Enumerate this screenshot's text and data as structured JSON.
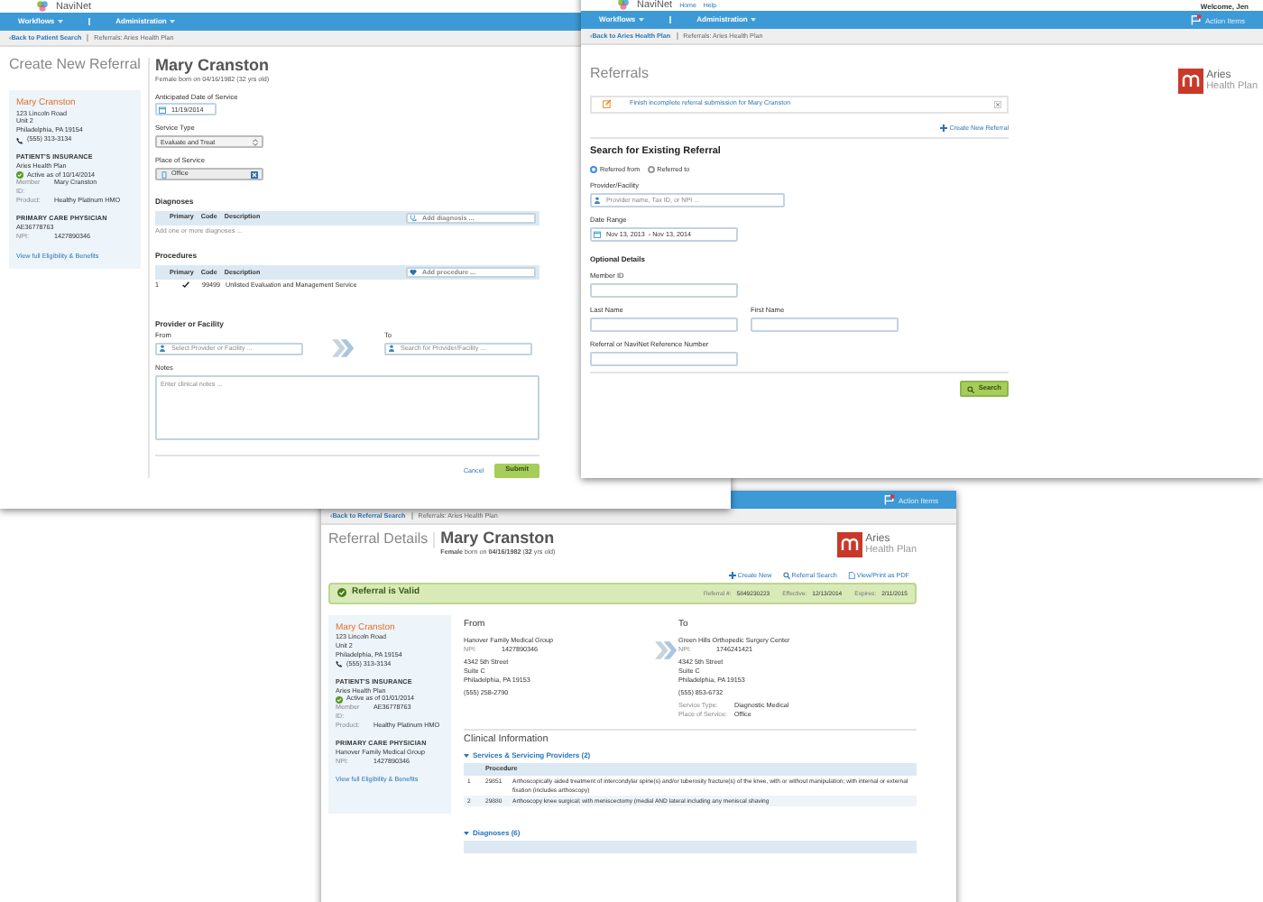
{
  "create_referral": {
    "logo": "NaviNet",
    "nav": [
      "Workflows",
      "Administration"
    ],
    "breadcrumb": {
      "back": "‹Back to Patient Search",
      "current": "Referrals: Aries Health Plan"
    },
    "title": "Create New Referral",
    "patient_card": {
      "name": "Mary Cranston",
      "address": [
        "123 Lincoln Road",
        "Unit 2",
        "Philadelphia, PA 19154"
      ],
      "phone": "(555) 313-3134",
      "insurance_heading": "PATIENT'S INSURANCE",
      "insurer": "Aries Health Plan",
      "status": "Active as of 10/14/2014",
      "fields": [
        {
          "label": "Member ID:",
          "value": "Mary Cranston"
        },
        {
          "label": "Product:",
          "value": "Healthy Platinum HMO"
        }
      ],
      "pcp_heading": "PRIMARY CARE PHYSICIAN",
      "pcp_name": "AE36778763",
      "pcp_npi": {
        "label": "NPI:",
        "value": "1427890346"
      },
      "link": "View full Eligibility & Benefits"
    },
    "patient_name": "Mary Cranston",
    "patient_info": "Female born on 04/16/1982 (32 yrs old)",
    "date_label": "Anticipated Date of Service",
    "date_value": "11/19/2014",
    "service_type_label": "Service Type",
    "service_type_value": "Evaluate and Treat",
    "place_label": "Place of Service",
    "place_value": "Office",
    "diagnoses": {
      "heading": "Diagnoses",
      "columns": [
        "Primary",
        "Code",
        "Description"
      ],
      "add_placeholder": "Add diagnosis ...",
      "empty_hint": "Add one or more diagnoses ..."
    },
    "procedures": {
      "heading": "Procedures",
      "columns": [
        "Primary",
        "Code",
        "Description"
      ],
      "add_placeholder": "Add procedure ...",
      "rows": [
        {
          "index": "1",
          "primary": true,
          "code": "99499",
          "description": "Unlisted Evaluation and Management Service"
        }
      ]
    },
    "provider_heading": "Provider or Facility",
    "from_label": "From",
    "from_placeholder": "Select Provider or Facility ...",
    "to_label": "To",
    "to_placeholder": "Search for Provider/Facility ...",
    "notes_label": "Notes",
    "notes_placeholder": "Enter clinical notes ...",
    "cancel": "Cancel",
    "submit": "Submit"
  },
  "referrals": {
    "logo": "NaviNet",
    "header_links": [
      "Home",
      "Help"
    ],
    "welcome": "Welcome, Jen",
    "nav": [
      "Workflows",
      "Administration"
    ],
    "action_items": "Action Items",
    "breadcrumb": {
      "back": "‹Back to Aries Health Plan",
      "current": "Referrals: Aries Health Plan"
    },
    "title": "Referrals",
    "plan_logo": {
      "name": "Aries",
      "sub": "Health Plan"
    },
    "alert": "Finish incomplete referral submission for Mary Cranston",
    "create_link": "Create New Referral",
    "search_heading": "Search for Existing Referral",
    "radios": [
      {
        "label": "Referred from",
        "selected": true
      },
      {
        "label": "Referred to",
        "selected": false
      }
    ],
    "provider_label": "Provider/Facility",
    "provider_placeholder": "Provider name, Tax ID, or NPI ...",
    "date_range_label": "Date Range",
    "date_range_value": "Nov 13, 2013  - Nov 13, 2014",
    "optional_heading": "Optional Details",
    "member_id_label": "Member ID",
    "last_name_label": "Last Name",
    "first_name_label": "First Name",
    "reference_label": "Referral or NaviNet Reference Number",
    "search_button": "Search"
  },
  "referral_details": {
    "action_items": "Action Items",
    "breadcrumb": {
      "back": "‹Back to Referral Search",
      "current": "Referrals: Aries Health Plan"
    },
    "title": "Referral Details",
    "patient_name": "Mary Cranston",
    "patient_info": "**Female** born on **04/16/1982** (**32** yrs old)",
    "plan_logo": {
      "name": "Aries",
      "sub": "Health Plan"
    },
    "links": [
      {
        "kind": "create",
        "label": "Create New"
      },
      {
        "kind": "search",
        "label": "Referral Search"
      },
      {
        "kind": "pdf",
        "label": "View/Print as PDF"
      }
    ],
    "status": {
      "label": "Referral is Valid",
      "fields": [
        {
          "label": "Referral #:",
          "value": "5849230223"
        },
        {
          "label": "Effective:",
          "value": "12/13/2014"
        },
        {
          "label": "Expires:",
          "value": "2/11/2015"
        }
      ]
    },
    "patient_card": {
      "name": "Mary Cranston",
      "address": [
        "123 Lincoln Road",
        "Unit 2",
        "Philadelphia, PA 19154"
      ],
      "phone": "(555) 313-3134",
      "insurance_heading": "PATIENT'S INSURANCE",
      "insurer": "Aries Health Plan",
      "status": "Active as of 01/01/2014",
      "fields": [
        {
          "label": "Member ID:",
          "value": "AE36778763"
        },
        {
          "label": "Product:",
          "value": "Healthy Platinum HMO"
        }
      ],
      "pcp_heading": "PRIMARY CARE PHYSICIAN",
      "pcp_name": "Hanover Family Medical Group",
      "pcp_npi": {
        "label": "NPI:",
        "value": "1427890346"
      },
      "link": "View full Eligibility & Benefits"
    },
    "from": {
      "heading": "From",
      "name": "Hanover Family Medical Group",
      "npi": {
        "label": "NPI:",
        "value": "1427890346"
      },
      "address": [
        "4342 5th Street",
        "Suite C",
        "Philadelphia, PA 19153"
      ],
      "phone": "(555) 258-2790"
    },
    "to": {
      "heading": "To",
      "name": "Green Hills Orthopedic Surgery Center",
      "npi": {
        "label": "NPI:",
        "value": "1746241421"
      },
      "address": [
        "4342 5th Street",
        "Suite C",
        "Philadelphia, PA 19153"
      ],
      "phone": "(555) 853-6732",
      "details": [
        {
          "label": "Service Type:",
          "value": "Diagnostic Medical"
        },
        {
          "label": "Place of Service:",
          "value": "Office"
        }
      ]
    },
    "clinical_heading": "Clinical Information",
    "services": {
      "heading": "Services & Servicing Providers (2)",
      "column": "Procedure",
      "rows": [
        {
          "index": "1",
          "code": "29851",
          "description": "Arthoscopically aided treatment of intercondylar spine(s) and/or tuberosity fracture(s) of the knee, with or without manipulation; with internal or external fixation (includes arthoscopy)"
        },
        {
          "index": "2",
          "code": "29880",
          "description": "Arthoscopy knee surgical; with meniscectomy (medial AND lateral including any meniscal shaving"
        }
      ]
    },
    "diagnoses_heading": "Diagnoses (6)"
  }
}
